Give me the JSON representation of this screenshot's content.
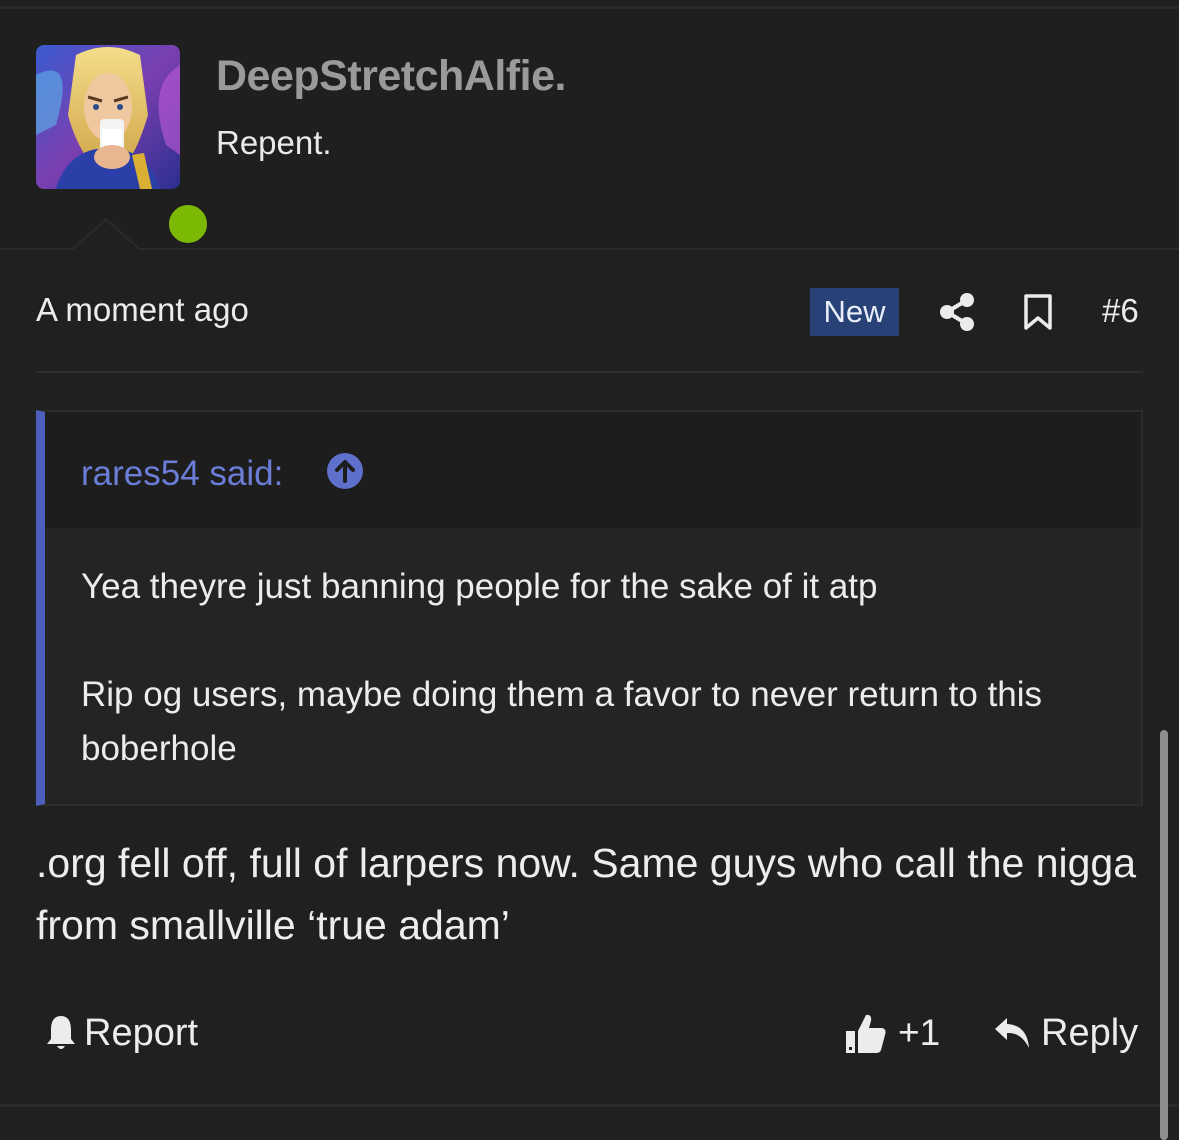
{
  "user": {
    "name": "DeepStretchAlfie.",
    "title": "Repent.",
    "online": true,
    "online_color": "#7cb905",
    "avatar_icon": "avatar-image"
  },
  "meta": {
    "time": "A moment ago",
    "badge": "New",
    "badge_color": "#284277",
    "post_number": "#6",
    "icons": [
      "share-icon",
      "bookmark-icon"
    ]
  },
  "quote": {
    "author_said": "rares54 said:",
    "accent_color": "#4d5ebd",
    "lines": [
      "Yea theyre just banning people for the sake of it atp",
      "Rip og users, maybe doing them a favor to never return to this boberhole"
    ]
  },
  "post": {
    "body": ".org fell off, full of larpers now. Same guys who call the nigga from smallville ‘true adam’"
  },
  "actions": {
    "report": "Report",
    "reaction_count": "+1",
    "reply": "Reply"
  }
}
